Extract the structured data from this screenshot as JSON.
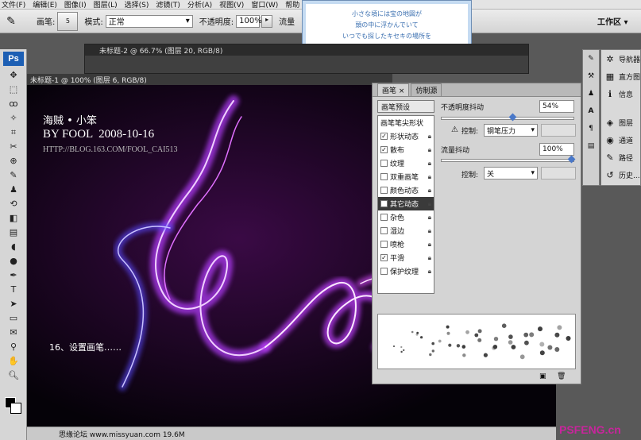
{
  "menu": [
    "文件(F)",
    "编辑(E)",
    "图像(I)",
    "图层(L)",
    "选择(S)",
    "滤镜(T)",
    "分析(A)",
    "视图(V)",
    "窗口(W)",
    "帮助"
  ],
  "options": {
    "brush_label": "画笔:",
    "brush_size": "5",
    "mode_label": "模式:",
    "mode_value": "正常",
    "opacity_label": "不透明度:",
    "opacity_value": "100%",
    "flow_label": "流量",
    "workspace_label": "工作区 ▾"
  },
  "tooltip_lines": [
    "小さな頃には宝の地図が",
    "頭の中に浮かんでいて",
    "いつでも探したキセキの場所を"
  ],
  "doc2_title": "未标题-2 @ 66.7% (图层 20, RGB/8)",
  "doc1_title": "未标题-1 @ 100% (图层 6, RGB/8)",
  "canvas_text": {
    "line1": "海贼 • 小笨",
    "line2": "BY FOOL  2008-10-16",
    "line3": "HTTP://BLOG.163.COM/FOOL_CAI513",
    "step": "16、设置画笔……"
  },
  "status_text": "思缘论坛  www.missyuan.com  19.6M",
  "watermark": "PSFENG.cn",
  "brush_panel": {
    "tabs": [
      "画笔 ×",
      "仿制源"
    ],
    "list_header": "画笔预设",
    "items": [
      {
        "label": "画笔笔尖形状",
        "checked": null,
        "selected": false
      },
      {
        "label": "形状动态",
        "checked": true,
        "selected": false
      },
      {
        "label": "散布",
        "checked": true,
        "selected": false
      },
      {
        "label": "纹理",
        "checked": false,
        "selected": false
      },
      {
        "label": "双重画笔",
        "checked": false,
        "selected": false
      },
      {
        "label": "颜色动态",
        "checked": false,
        "selected": false
      },
      {
        "label": "其它动态",
        "checked": true,
        "selected": true
      },
      {
        "label": "杂色",
        "checked": false,
        "selected": false
      },
      {
        "label": "湿边",
        "checked": false,
        "selected": false
      },
      {
        "label": "喷枪",
        "checked": false,
        "selected": false
      },
      {
        "label": "平滑",
        "checked": true,
        "selected": false
      },
      {
        "label": "保护纹理",
        "checked": false,
        "selected": false
      }
    ],
    "opacity_jitter_label": "不透明度抖动",
    "opacity_jitter_value": "54%",
    "opacity_jitter_fraction": 0.54,
    "control_label": "控制:",
    "control1_value": "钢笔压力",
    "flow_jitter_label": "流量抖动",
    "flow_jitter_value": "100%",
    "flow_jitter_fraction": 1.0,
    "control2_value": "关"
  },
  "dock_right": [
    {
      "icon": "navigator-icon",
      "glyph": "✲",
      "label": "导航器"
    },
    {
      "icon": "histogram-icon",
      "glyph": "▦",
      "label": "直方图"
    },
    {
      "icon": "info-icon",
      "glyph": "ℹ",
      "label": "信息"
    },
    {
      "icon": "layers-icon",
      "glyph": "◈",
      "label": "图层"
    },
    {
      "icon": "channels-icon",
      "glyph": "◉",
      "label": "通道"
    },
    {
      "icon": "paths-icon",
      "glyph": "✎",
      "label": "路径"
    },
    {
      "icon": "history-icon",
      "glyph": "↺",
      "label": "历史..."
    }
  ]
}
